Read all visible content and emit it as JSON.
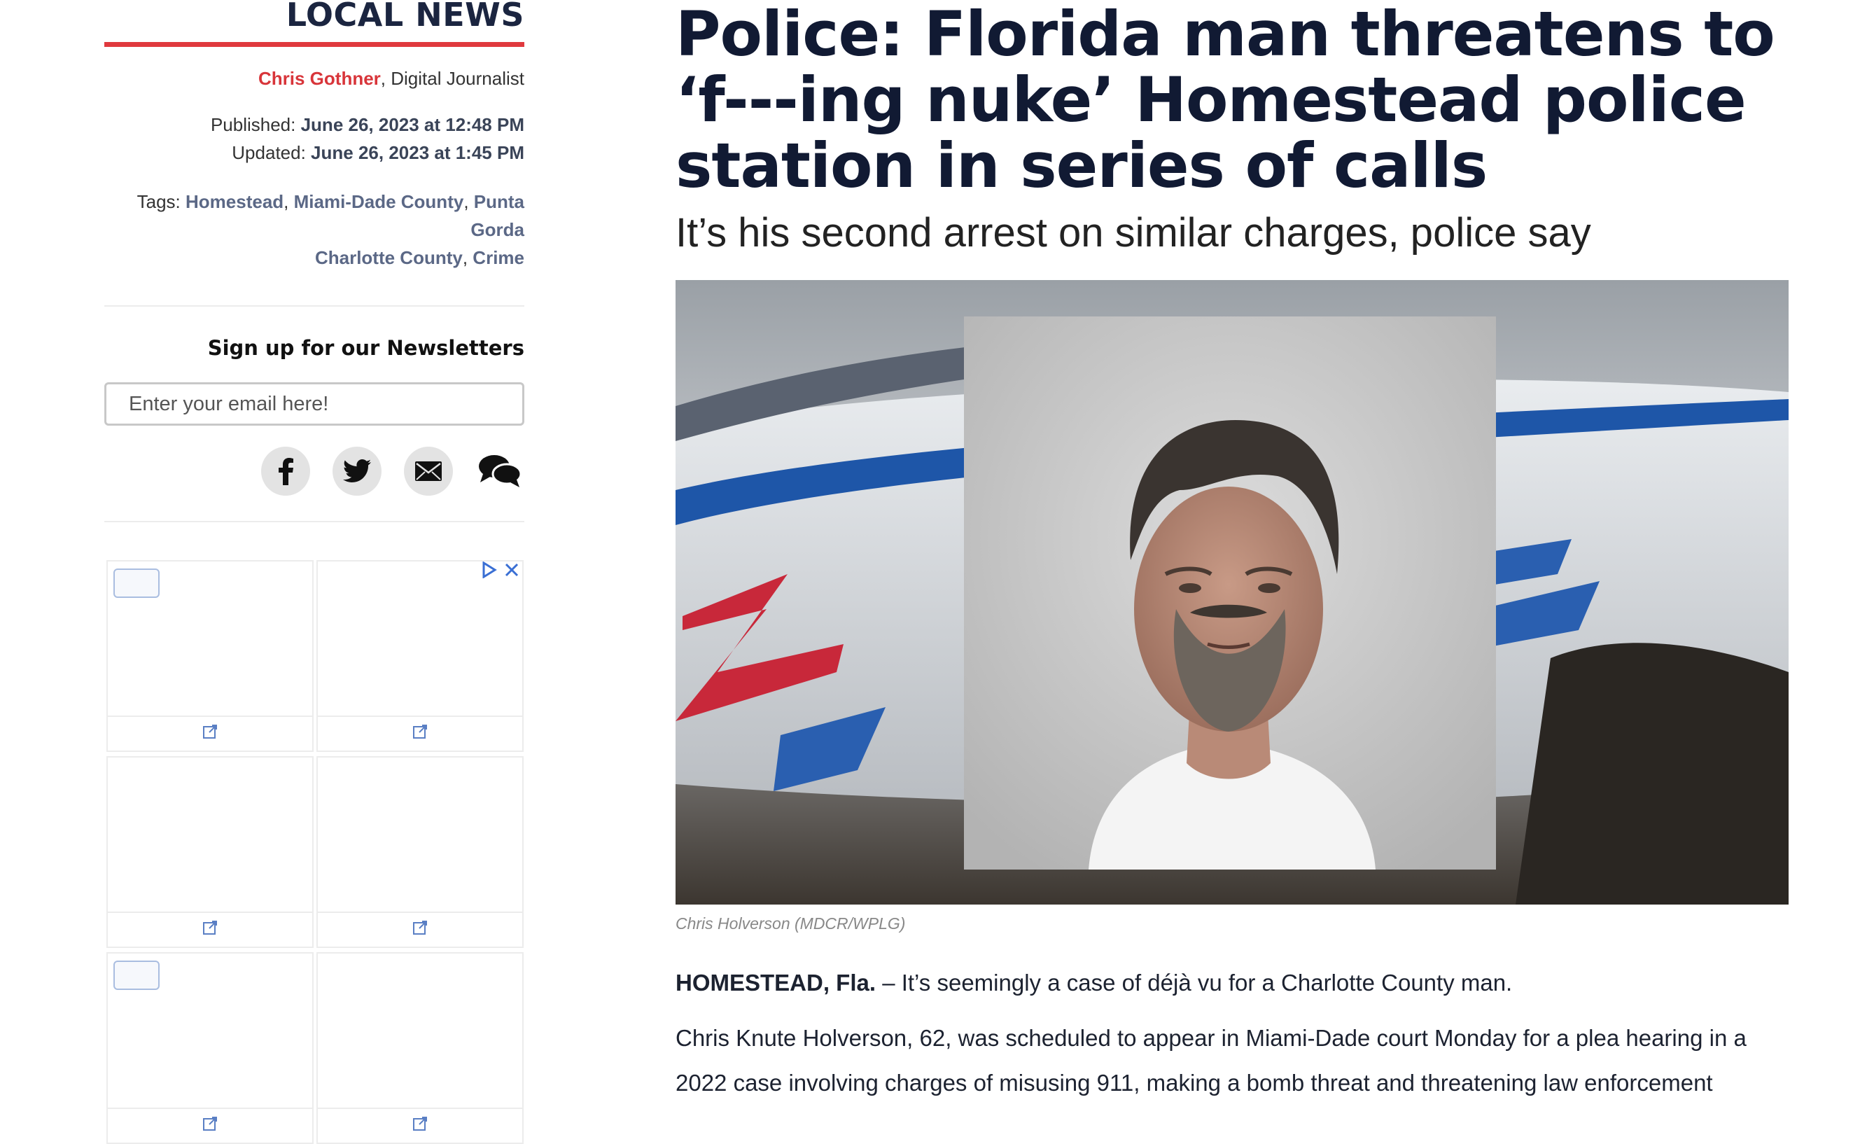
{
  "sidebar": {
    "section_title": "LOCAL NEWS",
    "author_name": "Chris Gothner",
    "author_role": ", Digital Journalist",
    "published_label": "Published:",
    "published_value": "June 26, 2023 at 12:48 PM",
    "updated_label": "Updated:",
    "updated_value": "June 26, 2023 at 1:45 PM",
    "tags_label": "Tags:",
    "tags": [
      "Homestead",
      "Miami-Dade County",
      "Punta Gorda",
      "Charlotte County",
      "Crime"
    ],
    "tag_separator": ", ",
    "newsletter_title": "Sign up for our Newsletters",
    "email_placeholder": "Enter your email here!",
    "social_icons": [
      "facebook-icon",
      "twitter-icon",
      "email-icon",
      "comments-icon"
    ]
  },
  "article": {
    "headline": "Police: Florida man threatens to ‘f---ing nuke’ Homestead police station in series of calls",
    "subheadline": "It’s his second arrest on similar charges, police say",
    "photo_caption": "Chris Holverson (MDCR/WPLG)",
    "dateline_place": "HOMESTEAD, Fla.",
    "dateline_text": " – It’s seemingly a case of déjà vu for a Charlotte County man.",
    "paragraph_1": "Chris Knute Holverson, 62, was scheduled to appear in Miami-Dade court Monday for a plea hearing in a 2022 case involving charges of misusing 911, making a bomb threat and threatening law enforcement"
  },
  "colors": {
    "accent_red": "#e0393e",
    "headline_navy": "#111a33",
    "tag_blue": "#5b6886"
  }
}
